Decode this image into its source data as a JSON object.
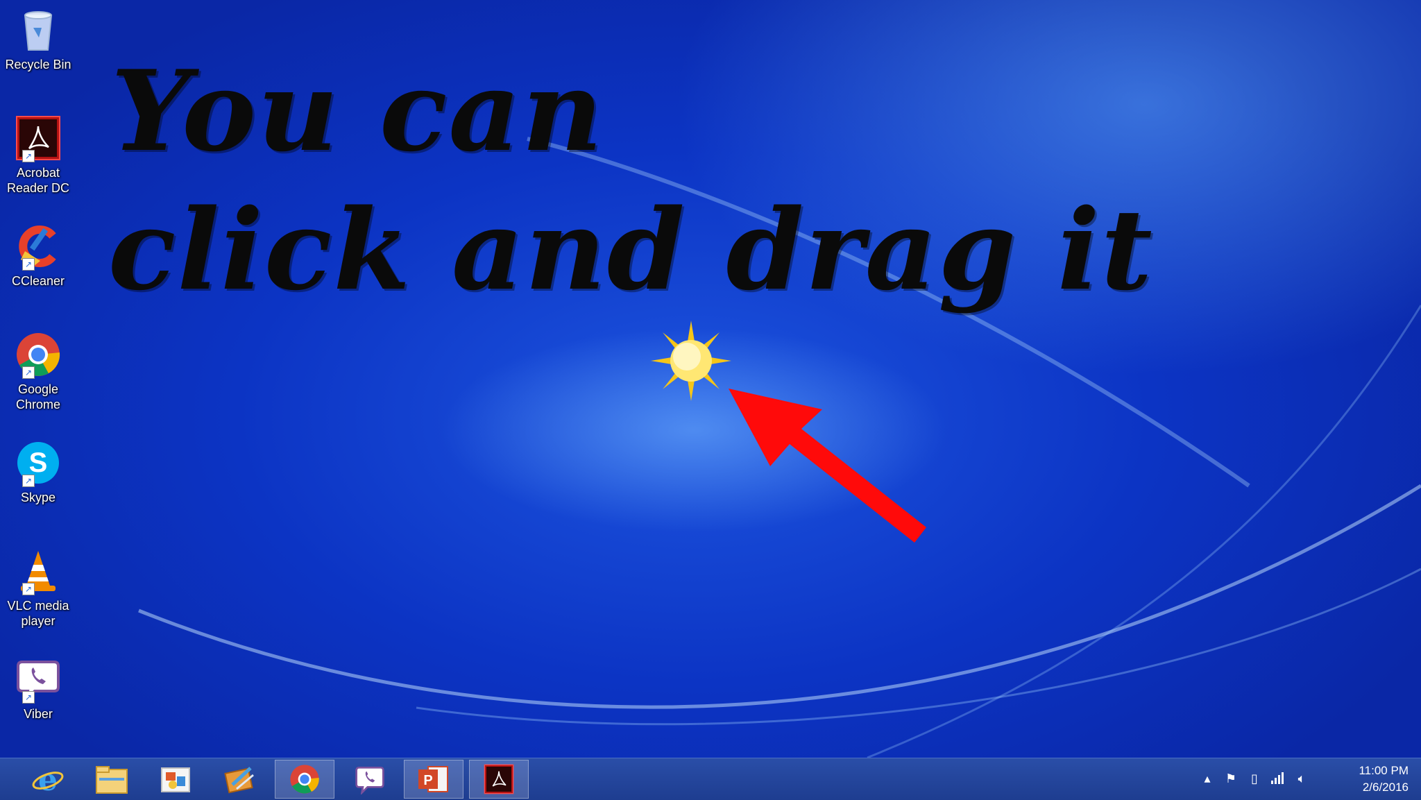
{
  "desktop": {
    "icons": [
      {
        "label": "Recycle Bin"
      },
      {
        "label": "Acrobat Reader DC"
      },
      {
        "label": "CCleaner"
      },
      {
        "label": "Google Chrome"
      },
      {
        "label": "Skype"
      },
      {
        "label": "VLC media player"
      },
      {
        "label": "Viber"
      }
    ],
    "overlay_text": {
      "line1": "You can",
      "line2": "click and drag it"
    },
    "annotation_color": "#ff0a0a"
  },
  "taskbar": {
    "apps": [
      "internet-explorer-icon",
      "file-explorer-icon",
      "photo-app-icon",
      "media-app-icon",
      "chrome-icon",
      "viber-icon",
      "powerpoint-icon",
      "acrobat-icon"
    ],
    "clock": {
      "time": "11:00 PM",
      "date": "2/6/2016"
    }
  }
}
